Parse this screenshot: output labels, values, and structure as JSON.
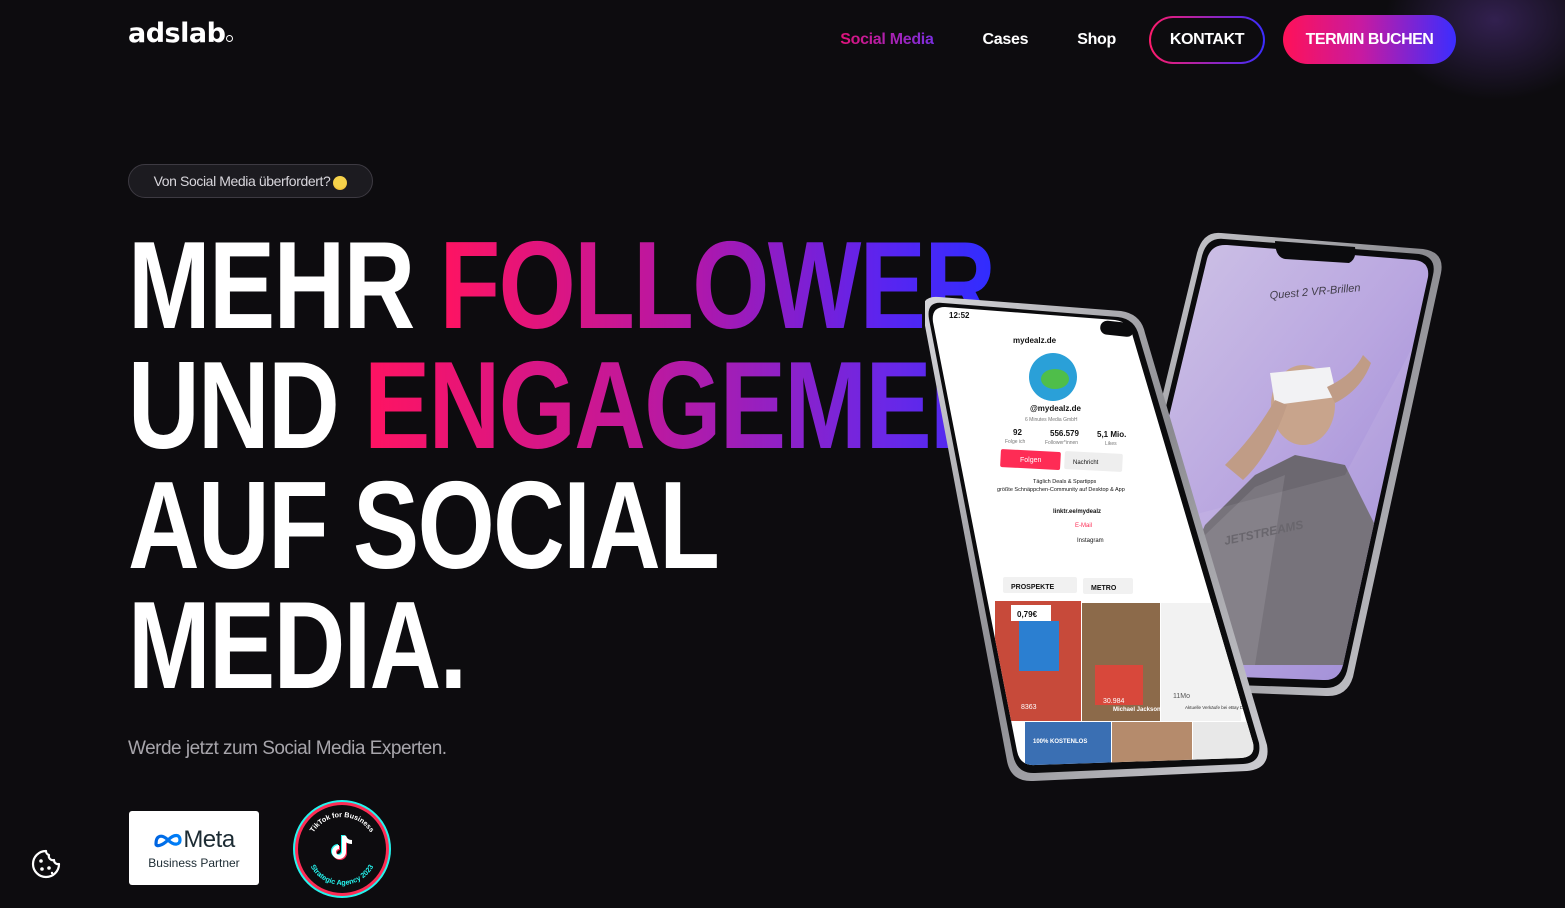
{
  "header": {
    "logo": "adslab",
    "nav": {
      "social_media": "Social Media",
      "cases": "Cases",
      "shop": "Shop"
    },
    "kontakt_label": "KONTAKT",
    "termin_label": "TERMIN BUCHEN"
  },
  "hero": {
    "badge": "Von Social Media überfordert?",
    "headline": {
      "line1_white": "MEHR ",
      "line1_gradient": "FOLLOWER",
      "line2_white": "UND ",
      "line2_gradient": "ENGAGEMENT",
      "line3": "AUF SOCIAL",
      "line4": "MEDIA."
    },
    "subtitle": "Werde jetzt zum Social Media Experten.",
    "partners": {
      "meta_name": "Meta",
      "meta_sub": "Business Partner",
      "tiktok_top": "TikTok for Business",
      "tiktok_bottom": "Strategic Agency 2023"
    }
  },
  "phone_profile": {
    "time": "12:52",
    "account": "mydealz.de",
    "handle": "@mydealz.de",
    "company": "6 Minutes Media GmbH",
    "stats": [
      {
        "value": "92",
        "label": "Folge ich"
      },
      {
        "value": "556.579",
        "label": "Follower*innen"
      },
      {
        "value": "5,1 Mio.",
        "label": "Likes"
      }
    ],
    "follow_button": "Folgen",
    "message_button": "Nachricht",
    "bio_line1": "Täglich Deals & Spartipps",
    "bio_line2": "größte Schnäppchen-Community auf Desktop & App",
    "link": "linktr.ee/mydealz",
    "email": "E-Mail",
    "instagram": "Instagram",
    "tab1": "PROSPEKTE",
    "tab2": "METRO",
    "price_tag": "0,79€",
    "views1": "8363",
    "views2": "30.984",
    "views3": "11Mo",
    "caption1": "Michael Jackson",
    "caption2": "100% KOSTENLOS",
    "caption3": "Aktuelle Verkäufe bei eBay Deutschland"
  },
  "phone_video": {
    "caption": "Quest 2 VR-Brillen",
    "shirt_text": "JETSTREAMS"
  },
  "colors": {
    "background": "#0d0c0f",
    "accent_pink": "#ff1361",
    "accent_blue": "#2f2dff",
    "tiktok_teal": "#25f4ee",
    "tiktok_red": "#fe2c55"
  },
  "icons": {
    "cookie": "cookie-icon",
    "badge_emoji": "scared-face-emoji-icon",
    "meta": "meta-infinity-icon",
    "tiktok": "tiktok-note-icon"
  }
}
